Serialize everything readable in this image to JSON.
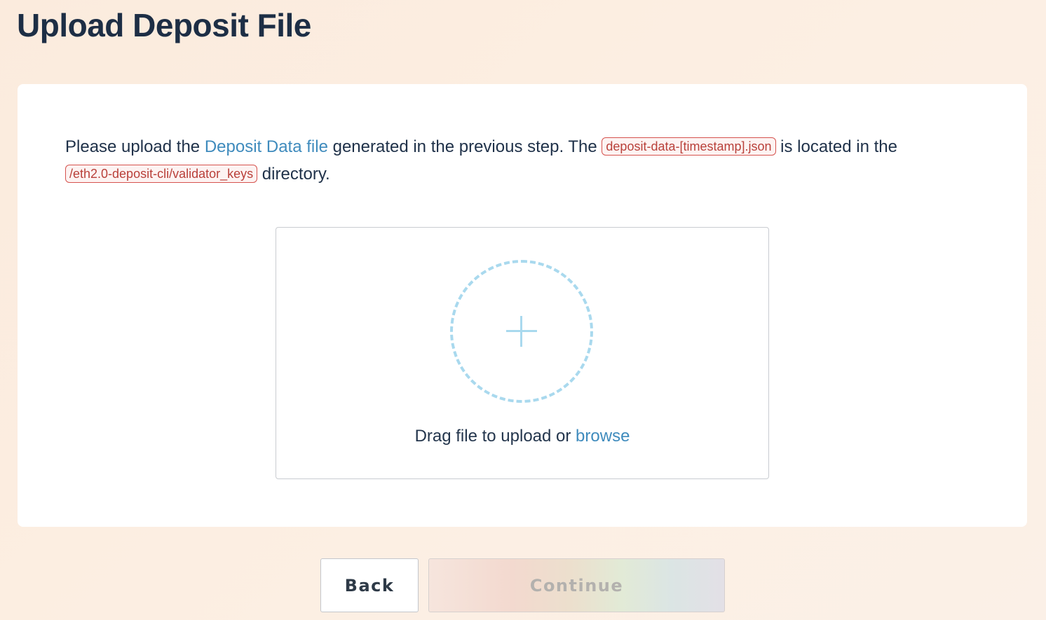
{
  "page": {
    "title": "Upload Deposit File"
  },
  "instructions": {
    "part1": "Please upload the ",
    "deposit_link": "Deposit Data file",
    "part2": " generated in the previous step. The ",
    "file_name": "deposit-data-[timestamp].json",
    "part3": " is located in the ",
    "directory": "/eth2.0-deposit-cli/validator_keys",
    "part4": " directory."
  },
  "dropzone": {
    "icon": "plus-icon",
    "text": "Drag file to upload or ",
    "browse_label": "browse"
  },
  "buttons": {
    "back_label": "Back",
    "continue_label": "Continue",
    "continue_disabled": true
  },
  "colors": {
    "link": "#3f8bbd",
    "code_text": "#b9403a",
    "code_border": "#d6534e",
    "dashed_circle": "#a9d9ee",
    "title": "#1d2e45"
  }
}
